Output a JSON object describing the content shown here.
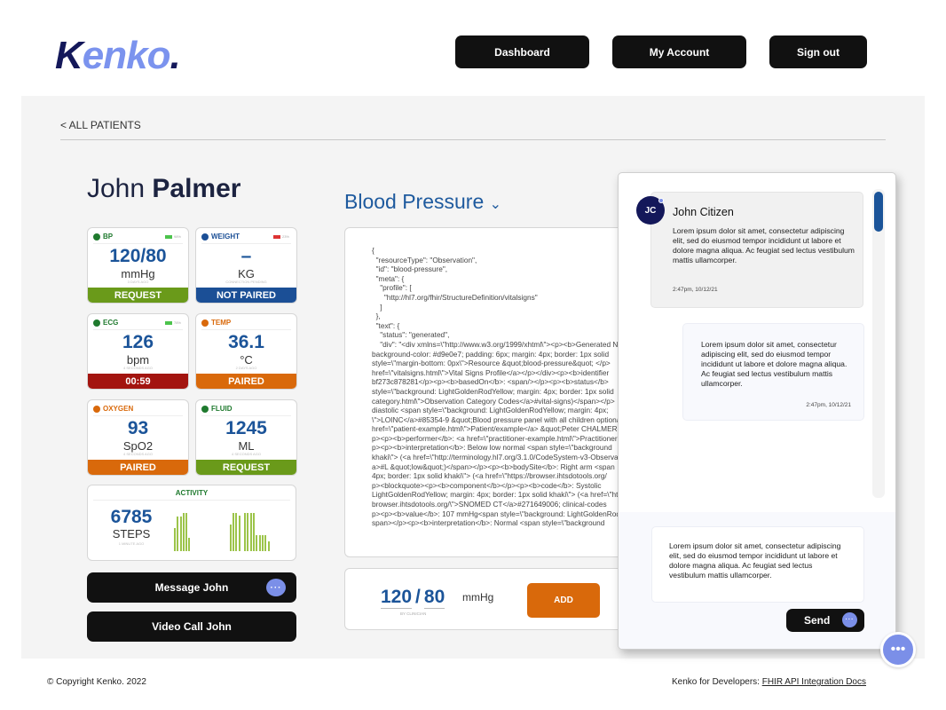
{
  "brand": {
    "logo_first": "K",
    "logo_rest": "enko",
    "logo_dot": "."
  },
  "nav": {
    "dashboard": "Dashboard",
    "account": "My Account",
    "signout": "Sign out"
  },
  "breadcrumb": "< ALL PATIENTS",
  "patient": {
    "first": "John",
    "last": "Palmer"
  },
  "vitals": [
    {
      "label": "BP",
      "status_color": "#1f7a2e",
      "battery": "98%",
      "battery_color": "#4cc34c",
      "value": "120/80",
      "unit": "mmHg",
      "ago": "3 DAYS AGO",
      "footer": "REQUEST",
      "footer_color": "#6a9a1a"
    },
    {
      "label": "WEIGHT",
      "status_color": "#1b4f96",
      "battery": "23%",
      "battery_color": "#d33",
      "value": "–",
      "unit": "KG",
      "ago": "CONNECTION PENDING",
      "footer": "NOT PAIRED",
      "footer_color": "#1b4f96"
    },
    {
      "label": "ECG",
      "status_color": "#1f7a2e",
      "battery": "78%",
      "battery_color": "#4cc34c",
      "value": "126",
      "unit": "bpm",
      "ago": "4 SECONDS AGO",
      "footer": "00:59",
      "footer_color": "#a3140f"
    },
    {
      "label": "TEMP",
      "status_color": "#d9690b",
      "battery": "",
      "battery_color": "",
      "value": "36.1",
      "unit": "°C",
      "ago": "2 DAYS AGO",
      "footer": "PAIRED",
      "footer_color": "#d9690b"
    },
    {
      "label": "OXYGEN",
      "status_color": "#d9690b",
      "battery": "",
      "battery_color": "",
      "value": "93",
      "unit": "SpO2",
      "ago": "4 SECONDS AGO",
      "footer": "PAIRED",
      "footer_color": "#d9690b"
    },
    {
      "label": "FLUID",
      "status_color": "#1f7a2e",
      "battery": "",
      "battery_color": "",
      "value": "1245",
      "unit": "ML",
      "ago": "4 SECONDS AGO",
      "footer": "REQUEST",
      "footer_color": "#6a9a1a"
    }
  ],
  "activity": {
    "title": "ACTIVITY",
    "value": "6785",
    "unit": "STEPS",
    "ago": "1 MINUTE AGO",
    "bar_color": "#9cc44a",
    "bars": [
      0.6,
      0.88,
      0.88,
      0.98,
      0.98,
      0.35,
      0,
      0,
      0,
      0,
      0,
      0,
      0,
      0,
      0,
      0,
      0,
      0,
      0,
      0.68,
      0.98,
      0.98,
      0.9,
      0,
      0.98,
      0.98,
      0.98,
      0.98,
      0.4,
      0.4,
      0.4,
      0.4,
      0.25
    ]
  },
  "actions": {
    "message": "Message John",
    "video": "Video Call John"
  },
  "observation": {
    "title": "Blood Pressure",
    "json_lines": [
      "{",
      "  \"resourceType\": \"Observation\",",
      "  \"id\": \"blood-pressure\",",
      "  \"meta\": {",
      "    \"profile\": [",
      "      \"http://hl7.org/fhir/StructureDefinition/vitalsigns\"",
      "    ]",
      "  },",
      "  \"text\": {",
      "    \"status\": \"generated\",",
      "    \"div\": \"<div xmlns=\\\"http://www.w3.org/1999/xhtml\\\"><p><b>Generated Narrative",
      "background-color: #d9e0e7; padding: 6px; margin: 4px; border: 1px solid",
      "style=\\\"margin-bottom: 0px\\\">Resource &quot;blood-pressure&quot; </p>",
      "href=\\\"vitalsigns.html\\\">Vital Signs Profile</a></p></div><p><b>identifier",
      "bf273c878281</p><p><b>basedOn</b>: <span/></p><p><b>status</b>",
      "style=\\\"background: LightGoldenRodYellow; margin: 4px; border: 1px solid",
      "category.html\\\">Observation Category Codes</a>#vital-signs)</span></p>",
      "diastolic <span style=\\\"background: LightGoldenRodYellow; margin: 4px;",
      "\\\">LOINC</a>#85354-9 &quot;Blood pressure panel with all children optional",
      "href=\\\"patient-example.html\\\">Patient/example</a> &quot;Peter CHALMERS",
      "p><p><b>performer</b>: <a href=\\\"practitioner-example.html\\\">Practitioner",
      "p><p><b>interpretation</b>: Below low normal <span style=\\\"background",
      "khaki\\\"> (<a href=\\\"http://terminology.hl7.org/3.1.0/CodeSystem-v3-ObservationInterpretation",
      "a>#L &quot;low&quot;)</span></p><p><b>bodySite</b>: Right arm <span",
      "4px; border: 1px solid khaki\\\"> (<a href=\\\"https://browser.ihtsdotools.org/",
      "p><blockquote><p><b>component</b></p><p><b>code</b>: Systolic",
      "LightGoldenRodYellow; margin: 4px; border: 1px solid khaki\\\"> (<a href=\\\"https://",
      "browser.ihtsdotools.org/\\\">SNOMED CT</a>#271649006; clinical-codes",
      "p><p><b>value</b>: 107 mmHg<span style=\\\"background: LightGoldenRodYellow",
      "span></p><p><b>interpretation</b>: Normal <span style=\\\"background"
    ]
  },
  "entry": {
    "systolic": "120",
    "sep": "/",
    "diastolic": "80",
    "unit": "mmHg",
    "source": "BY CLINICIAN",
    "add": "ADD"
  },
  "chat": {
    "contact_initials": "JC",
    "contact_name": "John Citizen",
    "messages": [
      {
        "text": "Lorem ipsum dolor sit amet, consectetur adipiscing elit, sed do eiusmod tempor incididunt ut labore et dolore magna aliqua. Ac feugiat sed lectus vestibulum mattis ullamcorper.",
        "time": "2:47pm, 10/12/21"
      },
      {
        "text": "Lorem ipsum dolor sit amet, consectetur adipiscing elit, sed do eiusmod tempor incididunt ut labore et dolore magna aliqua. Ac feugiat sed lectus vestibulum mattis ullamcorper.",
        "time": "2:47pm, 10/12/21"
      }
    ],
    "draft": "Lorem ipsum dolor sit amet, consectetur adipiscing elit, sed do eiusmod tempor incididunt ut labore et dolore magna aliqua. Ac feugiat sed lectus vestibulum mattis ullamcorper.",
    "send": "Send",
    "bubble_dots": "•••"
  },
  "footer": {
    "copyright": "© Copyright Kenko. 2022",
    "dev_prefix": "Kenko for Developers: ",
    "dev_link": "FHIR API Integration Docs"
  }
}
